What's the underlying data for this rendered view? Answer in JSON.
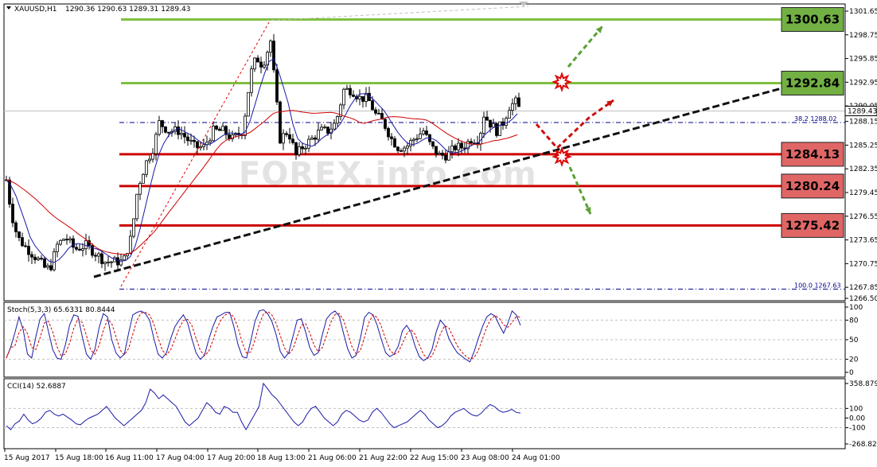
{
  "chart_data": {
    "type": "candlestick",
    "symbol": "XAUUSD,H1",
    "ohlc_header": "1290.36 1290.63 1289.31 1289.43",
    "current_price": "1289.43",
    "price_axis_ticks": [
      "1301.65",
      "1298.75",
      "1295.85",
      "1292.95",
      "1290.05",
      "1288.15",
      "1285.25",
      "1282.35",
      "1279.45",
      "1276.55",
      "1273.65",
      "1270.75",
      "1267.85",
      "1266.50"
    ],
    "ylim": [
      1266.5,
      1302.5
    ],
    "time_labels": [
      "15 Aug 2017",
      "15 Aug 18:00",
      "16 Aug 11:00",
      "17 Aug 04:00",
      "17 Aug 20:00",
      "18 Aug 13:00",
      "21 Aug 06:00",
      "21 Aug 22:00",
      "22 Aug 15:00",
      "23 Aug 08:00",
      "24 Aug 01:00"
    ],
    "levels": [
      {
        "value": 1300.63,
        "label": "1300.63",
        "kind": "resistance",
        "color": "#72b043"
      },
      {
        "value": 1292.84,
        "label": "1292.84",
        "kind": "resistance",
        "color": "#72b043"
      },
      {
        "value": 1284.13,
        "label": "1284.13",
        "kind": "support",
        "color": "#e06666"
      },
      {
        "value": 1280.24,
        "label": "1280.24",
        "kind": "support",
        "color": "#e06666"
      },
      {
        "value": 1275.42,
        "label": "1275.42",
        "kind": "support",
        "color": "#e06666"
      }
    ],
    "fibonacci": [
      {
        "label": "38.2",
        "value": "1288.02"
      },
      {
        "label": "100.0",
        "value": "1267.63"
      }
    ],
    "watermark": "FOREX.info.com",
    "stochastic": {
      "header": "Stoch(5,3,3) 65.6331 80.8444",
      "ticks": [
        "100",
        "80",
        "50",
        "20",
        "0"
      ],
      "values": [
        22,
        38,
        60,
        85,
        65,
        28,
        22,
        55,
        82,
        90,
        62,
        35,
        22,
        20,
        42,
        72,
        88,
        86,
        55,
        28,
        20,
        35,
        68,
        90,
        85,
        50,
        30,
        22,
        28,
        60,
        88,
        92,
        94,
        90,
        80,
        52,
        28,
        22,
        30,
        52,
        70,
        80,
        88,
        76,
        52,
        30,
        20,
        26,
        50,
        70,
        85,
        88,
        92,
        92,
        70,
        42,
        24,
        22,
        48,
        78,
        94,
        96,
        90,
        78,
        58,
        32,
        22,
        30,
        55,
        80,
        82,
        62,
        38,
        26,
        30,
        58,
        82,
        90,
        94,
        86,
        60,
        36,
        22,
        26,
        52,
        84,
        92,
        88,
        72,
        50,
        30,
        24,
        28,
        40,
        64,
        72,
        62,
        40,
        24,
        18,
        22,
        35,
        62,
        80,
        72,
        52,
        40,
        30,
        25,
        20,
        16,
        32,
        52,
        70,
        85,
        90,
        86,
        72,
        60,
        75,
        94,
        88,
        72
      ]
    },
    "cci": {
      "header": "CCI(14) 52.6887",
      "ticks": [
        "358.8794",
        "100",
        "0.00",
        "-100",
        "-268.8279"
      ],
      "values": [
        -80,
        -120,
        -60,
        -30,
        40,
        -20,
        -60,
        -40,
        0,
        60,
        80,
        40,
        20,
        40,
        10,
        -20,
        -60,
        -70,
        -30,
        0,
        20,
        40,
        80,
        120,
        60,
        0,
        -40,
        -80,
        -40,
        0,
        40,
        80,
        160,
        300,
        260,
        200,
        240,
        200,
        160,
        120,
        40,
        -40,
        -80,
        -40,
        0,
        80,
        160,
        120,
        60,
        40,
        120,
        100,
        60,
        60,
        -40,
        -120,
        -40,
        40,
        120,
        360,
        300,
        240,
        200,
        140,
        80,
        20,
        -40,
        -80,
        -40,
        40,
        100,
        120,
        60,
        0,
        -40,
        -80,
        -40,
        40,
        80,
        60,
        20,
        -20,
        -40,
        -20,
        60,
        100,
        60,
        0,
        -60,
        -100,
        -80,
        -60,
        -40,
        0,
        40,
        80,
        40,
        -20,
        -60,
        -100,
        -80,
        -40,
        20,
        60,
        80,
        100,
        60,
        30,
        20,
        50,
        100,
        140,
        120,
        80,
        60,
        70,
        90,
        60,
        52
      ]
    }
  }
}
